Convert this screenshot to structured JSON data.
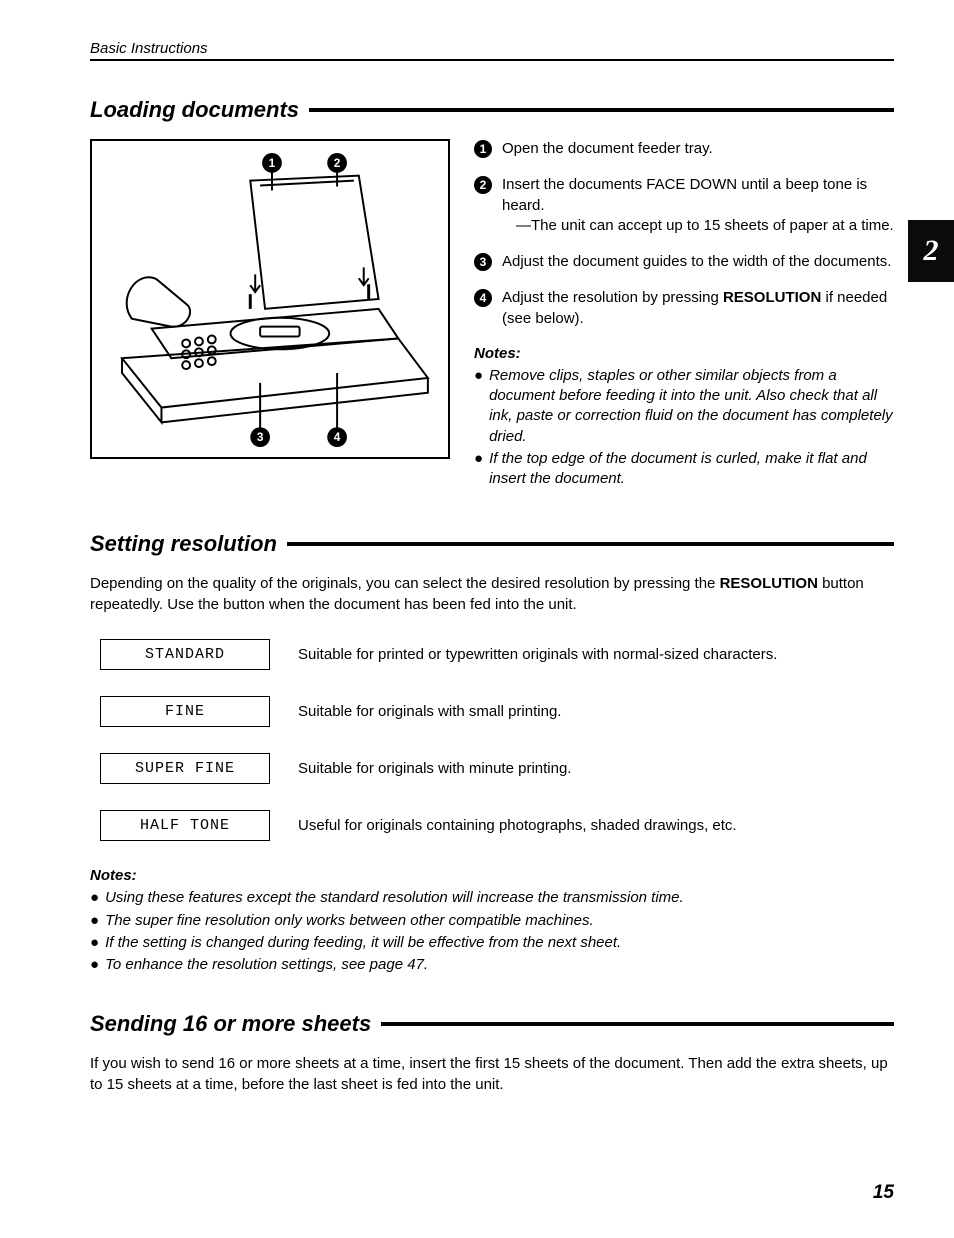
{
  "header": "Basic Instructions",
  "tab": "2",
  "page_number": "15",
  "sections": {
    "loading": {
      "title": "Loading documents",
      "steps": [
        {
          "n": "1",
          "text": "Open the document feeder tray."
        },
        {
          "n": "2",
          "text": "Insert the documents FACE DOWN until a beep tone is heard.",
          "sub": "—The unit can accept up to 15 sheets of paper at a time."
        },
        {
          "n": "3",
          "text": "Adjust the document guides to the width of the documents."
        },
        {
          "n": "4",
          "text_a": "Adjust the resolution by pressing ",
          "text_bold": "RESOLUTION",
          "text_b": " if needed (see below)."
        }
      ],
      "notes_label": "Notes:",
      "notes": [
        "Remove clips, staples or other similar objects from a document before feeding it into the unit. Also check that all ink, paste or correction fluid on the document has completely dried.",
        "If the top edge of the document is curled, make it flat and insert the document."
      ]
    },
    "resolution": {
      "title": "Setting resolution",
      "intro_a": "Depending on the quality of the originals, you can select the desired resolution by pressing the ",
      "intro_bold": "RESOLUTION",
      "intro_b": " button repeatedly. Use the button when the document has been fed into the unit.",
      "rows": [
        {
          "label": "STANDARD",
          "desc": "Suitable for printed or typewritten originals with normal-sized characters."
        },
        {
          "label": "FINE",
          "desc": "Suitable for originals with small printing."
        },
        {
          "label": "SUPER FINE",
          "desc": "Suitable for originals with minute printing."
        },
        {
          "label": "HALF TONE",
          "desc": "Useful for originals containing photographs, shaded drawings, etc."
        }
      ],
      "notes_label": "Notes:",
      "notes": [
        "Using these features except the standard resolution will increase the transmission time.",
        "The super fine resolution only works between other compatible machines.",
        "If the setting is changed during feeding, it will be effective from the next sheet.",
        "To enhance the resolution settings, see page 47."
      ]
    },
    "sending": {
      "title": "Sending 16 or more sheets",
      "body": "If you wish to send 16 or more sheets at a time, insert the first 15 sheets of the document. Then add the extra sheets, up to 15 sheets at a time, before the last sheet is fed into the unit."
    }
  }
}
